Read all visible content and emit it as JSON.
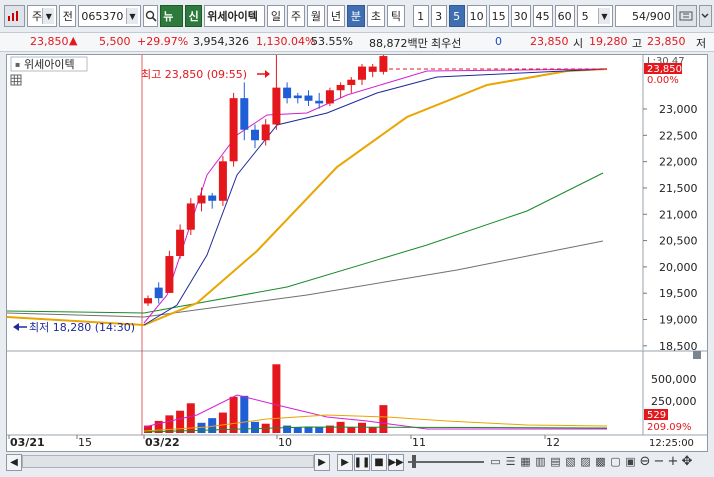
{
  "toolbar": {
    "market": "주",
    "jeon": "전",
    "code": "065370",
    "news": "뉴",
    "shin": "신",
    "name": "위세아이텍",
    "periods": [
      "일",
      "주",
      "월",
      "년",
      "분",
      "초",
      "틱"
    ],
    "active_period": "분",
    "intervals": [
      "1",
      "3",
      "5",
      "10",
      "15",
      "30",
      "45",
      "60"
    ],
    "active_interval": "5",
    "custom_interval": "5",
    "count": "54",
    "count_total": "/900"
  },
  "infobar": {
    "price": "23,850",
    "change": "5,500",
    "change_rate": "+29.97%",
    "volume": "3,954,326",
    "volume_rate": "1,130.04%",
    "ratio": "53.55%",
    "amount": "88,872백만",
    "priority_label": "최우선",
    "priority_value": "0",
    "price2": "23,850",
    "start_label": "시",
    "start_value": "19,280",
    "high_label": "고",
    "high_value": "23,850",
    "low_label": "저"
  },
  "chart_data": {
    "type": "candlestick",
    "title": "위세아이텍",
    "y_axis_ticks": [
      "23,000",
      "22,500",
      "22,000",
      "21,500",
      "21,000",
      "20,500",
      "20,000",
      "19,500",
      "19,000",
      "18,500"
    ],
    "price_tag": "23,850",
    "price_tag_sub": "0.00%",
    "top_right_label": "L:30.47",
    "high_annotation": "최고 23,850 (09:55)",
    "low_annotation": "최저 18,280 (14:30)",
    "volume_ticks": [
      "500,000",
      "250,000"
    ],
    "volume_tag": "529",
    "volume_tag_sub": "209.09%",
    "x_labels": [
      "03/21",
      "15",
      "03/22",
      "10",
      "11",
      "12"
    ],
    "time_label": "12:25:00",
    "candles": [
      {
        "o": 19100,
        "h": 19250,
        "l": 19050,
        "c": 19200,
        "dir": "up"
      },
      {
        "o": 19200,
        "h": 19500,
        "l": 19100,
        "c": 19400,
        "dir": "down"
      },
      {
        "o": 19300,
        "h": 20100,
        "l": 19300,
        "c": 20000,
        "dir": "up"
      },
      {
        "o": 20000,
        "h": 20600,
        "l": 19950,
        "c": 20500,
        "dir": "up"
      },
      {
        "o": 20500,
        "h": 21100,
        "l": 20400,
        "c": 21000,
        "dir": "up"
      },
      {
        "o": 21000,
        "h": 21300,
        "l": 20850,
        "c": 21150,
        "dir": "up"
      },
      {
        "o": 21150,
        "h": 21200,
        "l": 20900,
        "c": 21050,
        "dir": "down"
      },
      {
        "o": 21050,
        "h": 21900,
        "l": 20950,
        "c": 21800,
        "dir": "up"
      },
      {
        "o": 21800,
        "h": 23100,
        "l": 21700,
        "c": 23000,
        "dir": "up"
      },
      {
        "o": 23000,
        "h": 23300,
        "l": 22200,
        "c": 22400,
        "dir": "down"
      },
      {
        "o": 22400,
        "h": 22500,
        "l": 22050,
        "c": 22200,
        "dir": "down"
      },
      {
        "o": 22200,
        "h": 22600,
        "l": 22100,
        "c": 22500,
        "dir": "up"
      },
      {
        "o": 22500,
        "h": 23850,
        "l": 22400,
        "c": 23200,
        "dir": "up"
      },
      {
        "o": 23200,
        "h": 23300,
        "l": 22900,
        "c": 23000,
        "dir": "down"
      },
      {
        "o": 23000,
        "h": 23100,
        "l": 22900,
        "c": 23050,
        "dir": "down"
      },
      {
        "o": 23050,
        "h": 23150,
        "l": 22850,
        "c": 22950,
        "dir": "down"
      },
      {
        "o": 22950,
        "h": 23100,
        "l": 22800,
        "c": 22900,
        "dir": "down"
      },
      {
        "o": 22900,
        "h": 23200,
        "l": 22850,
        "c": 23150,
        "dir": "up"
      },
      {
        "o": 23150,
        "h": 23300,
        "l": 23000,
        "c": 23250,
        "dir": "up"
      },
      {
        "o": 23250,
        "h": 23400,
        "l": 23100,
        "c": 23350,
        "dir": "up"
      },
      {
        "o": 23350,
        "h": 23650,
        "l": 23250,
        "c": 23600,
        "dir": "up"
      },
      {
        "o": 23600,
        "h": 23650,
        "l": 23400,
        "c": 23500,
        "dir": "up"
      },
      {
        "o": 23500,
        "h": 23850,
        "l": 23450,
        "c": 23800,
        "dir": "up"
      }
    ],
    "volumes": [
      {
        "v": 40000,
        "dir": "up"
      },
      {
        "v": 65000,
        "dir": "up"
      },
      {
        "v": 95000,
        "dir": "up"
      },
      {
        "v": 120000,
        "dir": "up"
      },
      {
        "v": 160000,
        "dir": "up"
      },
      {
        "v": 55000,
        "dir": "down"
      },
      {
        "v": 80000,
        "dir": "down"
      },
      {
        "v": 110000,
        "dir": "up"
      },
      {
        "v": 195000,
        "dir": "up"
      },
      {
        "v": 200000,
        "dir": "down"
      },
      {
        "v": 60000,
        "dir": "down"
      },
      {
        "v": 50000,
        "dir": "up"
      },
      {
        "v": 370000,
        "dir": "up"
      },
      {
        "v": 40000,
        "dir": "down"
      },
      {
        "v": 30000,
        "dir": "down"
      },
      {
        "v": 35000,
        "dir": "down"
      },
      {
        "v": 30000,
        "dir": "down"
      },
      {
        "v": 40000,
        "dir": "up"
      },
      {
        "v": 60000,
        "dir": "up"
      },
      {
        "v": 30000,
        "dir": "up"
      },
      {
        "v": 55000,
        "dir": "up"
      },
      {
        "v": 30000,
        "dir": "up"
      },
      {
        "v": 150000,
        "dir": "up"
      }
    ],
    "colors": {
      "up": "#e3171c",
      "down": "#1f5ed6",
      "ma5": "#d21fd4",
      "ma10": "#1f2a9a",
      "ma20": "#e9a500",
      "ma60": "#1a8a2a",
      "ma120": "#707070"
    }
  },
  "scroll": {
    "arrow_left": "◀",
    "arrow_right": "▶"
  }
}
